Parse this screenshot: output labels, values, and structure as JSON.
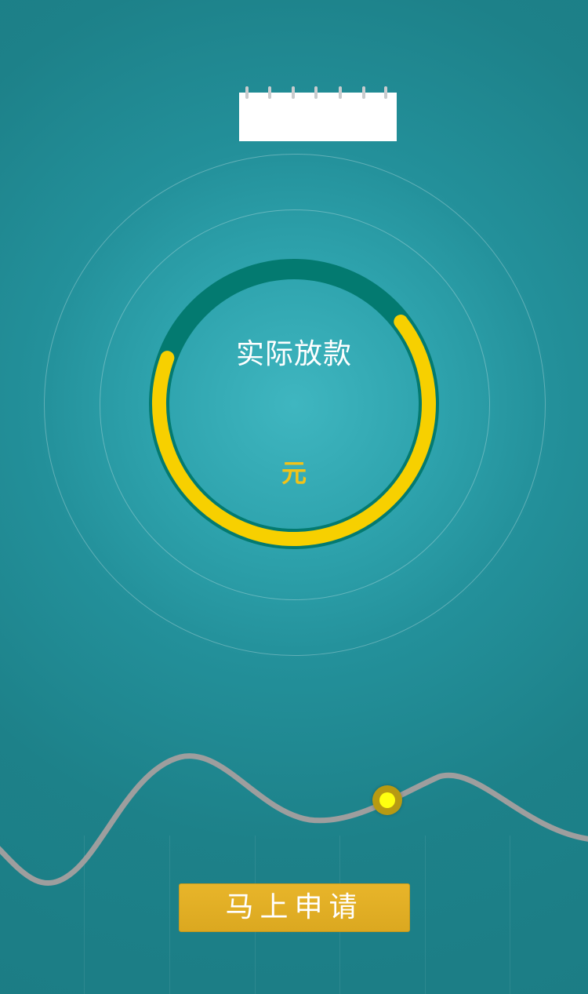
{
  "gauge": {
    "title": "实际放款",
    "amount": "",
    "unit": "元",
    "progress": 0.66
  },
  "calendar": {
    "date_text": ""
  },
  "slider": {
    "value_fraction": 0.66
  },
  "apply_button": {
    "label": "马上申请"
  },
  "colors": {
    "background": "#1d8189",
    "gauge_track": "#037a70",
    "gauge_progress": "#f7d000",
    "accent_text": "#f2c318",
    "button": "#e2af24",
    "slider_handle": "#ffff10",
    "wave_line": "#9e9e9e"
  },
  "icons": {
    "calendar": "calendar-icon",
    "slider_handle": "slider-knob-icon"
  }
}
